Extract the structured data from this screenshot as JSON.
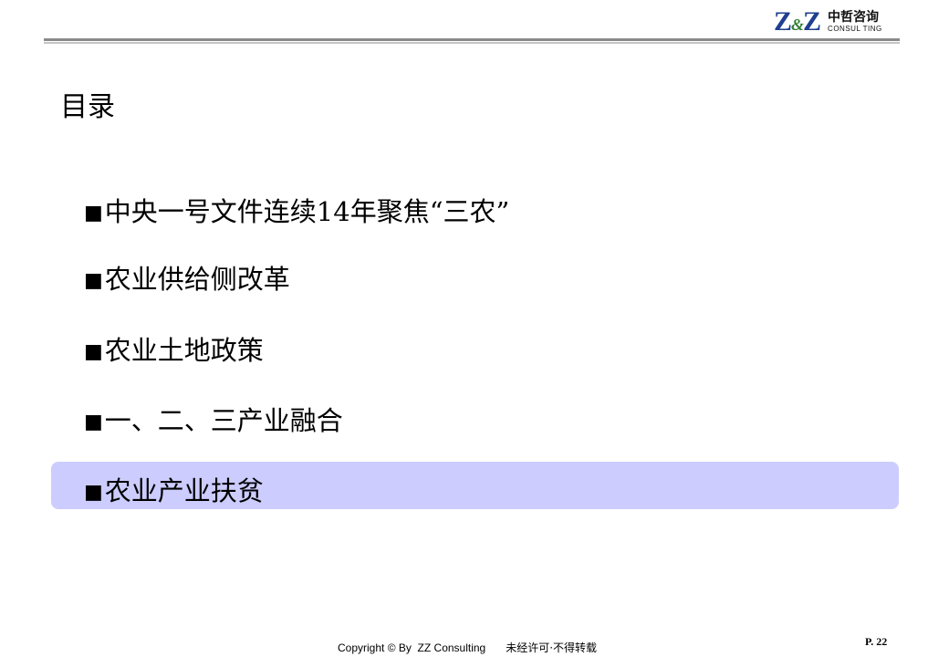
{
  "header": {
    "logo_mark": "Z&Z",
    "logo_mark_left": "Z",
    "logo_mark_amp": "&",
    "logo_mark_right": "Z",
    "logo_cn": "中哲咨询",
    "logo_en": "CONSUL TING"
  },
  "title": "目录",
  "toc": {
    "bullet": "■",
    "items": [
      {
        "label": "中央一号文件连续14年聚焦“三农”",
        "active": false
      },
      {
        "label": "农业供给侧改革",
        "active": false
      },
      {
        "label": "农业土地政策",
        "active": false
      },
      {
        "label": "一、二、三产业融合",
        "active": false
      },
      {
        "label": "农业产业扶贫",
        "active": true
      }
    ]
  },
  "colors": {
    "highlight": "#ccccff",
    "rule_dark": "#8a8a8a",
    "rule_light": "#c4c4c4",
    "logo_blue": "#1f3f8f"
  },
  "footer": {
    "copyright": "Copyright © By  ZZ Consulting",
    "notice": "未经许可·不得转载",
    "page": "P. 22"
  }
}
